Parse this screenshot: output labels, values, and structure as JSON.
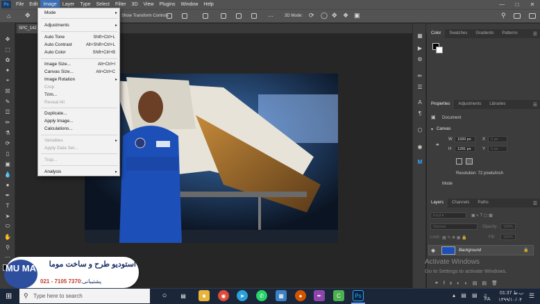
{
  "menubar": {
    "items": [
      "File",
      "Edit",
      "Image",
      "Layer",
      "Type",
      "Select",
      "Filter",
      "3D",
      "View",
      "Plugins",
      "Window",
      "Help"
    ],
    "app_icon": "Ps"
  },
  "options_bar": {
    "transform_controls": "Show Transform Controls",
    "mode_3d": "3D Mode:"
  },
  "document": {
    "tab_name": "SPC_142"
  },
  "image_menu": {
    "items": [
      {
        "label": "Mode",
        "shortcut": "",
        "submenu": true,
        "disabled": false
      },
      {
        "label": "Adjustments",
        "shortcut": "",
        "submenu": true,
        "disabled": false
      },
      {
        "label": "Auto Tone",
        "shortcut": "Shift+Ctrl+L",
        "submenu": false,
        "disabled": false
      },
      {
        "label": "Auto Contrast",
        "shortcut": "Alt+Shift+Ctrl+L",
        "submenu": false,
        "disabled": false
      },
      {
        "label": "Auto Color",
        "shortcut": "Shift+Ctrl+B",
        "submenu": false,
        "disabled": false
      },
      {
        "label": "Image Size...",
        "shortcut": "Alt+Ctrl+I",
        "submenu": false,
        "disabled": false
      },
      {
        "label": "Canvas Size...",
        "shortcut": "Alt+Ctrl+C",
        "submenu": false,
        "disabled": false
      },
      {
        "label": "Image Rotation",
        "shortcut": "",
        "submenu": true,
        "disabled": false
      },
      {
        "label": "Crop",
        "shortcut": "",
        "submenu": false,
        "disabled": true
      },
      {
        "label": "Trim...",
        "shortcut": "",
        "submenu": false,
        "disabled": false
      },
      {
        "label": "Reveal All",
        "shortcut": "",
        "submenu": false,
        "disabled": true
      },
      {
        "label": "Duplicate...",
        "shortcut": "",
        "submenu": false,
        "disabled": false
      },
      {
        "label": "Apply Image...",
        "shortcut": "",
        "submenu": false,
        "disabled": false
      },
      {
        "label": "Calculations...",
        "shortcut": "",
        "submenu": false,
        "disabled": false
      },
      {
        "label": "Variables",
        "shortcut": "",
        "submenu": true,
        "disabled": true
      },
      {
        "label": "Apply Data Set...",
        "shortcut": "",
        "submenu": false,
        "disabled": true
      },
      {
        "label": "Trap...",
        "shortcut": "",
        "submenu": false,
        "disabled": true
      },
      {
        "label": "Analysis",
        "shortcut": "",
        "submenu": true,
        "disabled": false
      }
    ]
  },
  "color_panel": {
    "tabs": [
      "Color",
      "Swatches",
      "Gradients",
      "Patterns"
    ],
    "hue_color": "#ff3300"
  },
  "properties_panel": {
    "tabs": [
      "Properties",
      "Adjustments",
      "Libraries"
    ],
    "document_label": "Document",
    "canvas_label": "Canvas",
    "w_label": "W",
    "w_value": "1920 px",
    "x_label": "X",
    "x_value": "0 px",
    "h_label": "H",
    "h_value": "1281 px",
    "y_label": "Y",
    "y_value": "0 px",
    "resolution": "Resolution: 72 pixels/inch",
    "mode_label": "Mode"
  },
  "layers_panel": {
    "tabs": [
      "Layers",
      "Channels",
      "Paths"
    ],
    "kind": "Kind",
    "blend": "Normal",
    "opacity_label": "Opacity:",
    "opacity_value": "100%",
    "lock_label": "Lock:",
    "fill_label": "Fill:",
    "fill_value": "100%",
    "layer_name": "Background"
  },
  "watermark": {
    "line1": "Activate Windows",
    "line2": "Go to Settings to activate Windows."
  },
  "logo": {
    "mark": "MU MA",
    "title": "استودیو طرح و ساخت موما",
    "support_label": "پشتیبانی:",
    "phone": "021 - 7105 7370"
  },
  "taskbar": {
    "search_placeholder": "Type here to search",
    "time": "ب.ظ 01:37",
    "date": "۱۳۹۹/۱۰/۰۴",
    "language": "FA"
  }
}
